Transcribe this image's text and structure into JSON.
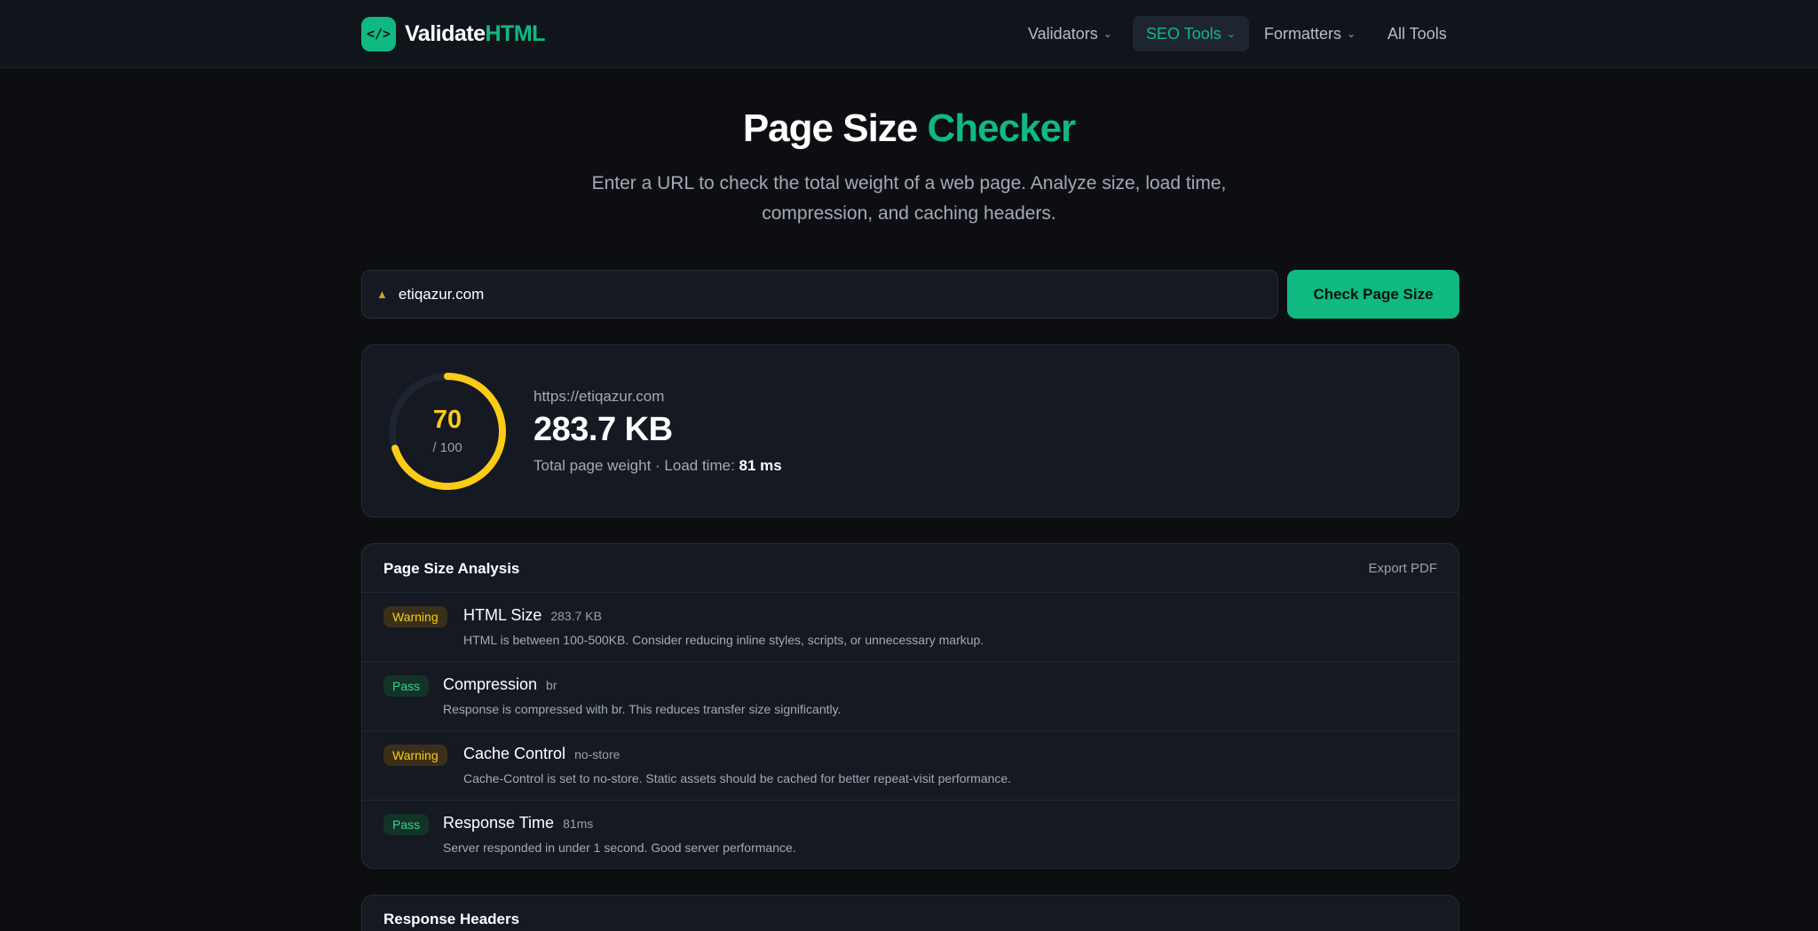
{
  "brand": {
    "icon_text": "</>",
    "name_part1": "Validate",
    "name_part2": "HTML"
  },
  "nav": {
    "validators": "Validators",
    "seo_tools": "SEO Tools",
    "formatters": "Formatters",
    "all_tools": "All Tools",
    "active": "SEO Tools"
  },
  "hero": {
    "title_part1": "Page Size",
    "title_part2": "Checker",
    "subtitle": "Enter a URL to check the total weight of a web page. Analyze size, load time, compression, and caching headers."
  },
  "search": {
    "value": "etiqazur.com",
    "button_label": "Check Page Size"
  },
  "score": {
    "value": "70",
    "max_label": "/ 100",
    "fraction": 0.7,
    "color": "#facc15",
    "url": "https://etiqazur.com",
    "size": "283.7 KB",
    "meta_prefix": "Total page weight · Load time:",
    "load_time": "81 ms"
  },
  "analysis": {
    "title": "Page Size Analysis",
    "export_label": "Export PDF",
    "rows": [
      {
        "status": "Warning",
        "title": "HTML Size",
        "value": "283.7 KB",
        "desc": "HTML is between 100-500KB. Consider reducing inline styles, scripts, or unnecessary markup."
      },
      {
        "status": "Pass",
        "title": "Compression",
        "value": "br",
        "desc": "Response is compressed with br. This reduces transfer size significantly."
      },
      {
        "status": "Warning",
        "title": "Cache Control",
        "value": "no-store",
        "desc": "Cache-Control is set to no-store. Static assets should be cached for better repeat-visit performance."
      },
      {
        "status": "Pass",
        "title": "Response Time",
        "value": "81ms",
        "desc": "Server responded in under 1 second. Good server performance."
      }
    ]
  },
  "headers": {
    "title": "Response Headers"
  },
  "colors": {
    "accent": "#10b981",
    "warning": "#facc15",
    "pass": "#34d399",
    "background": "#0c0e12"
  }
}
